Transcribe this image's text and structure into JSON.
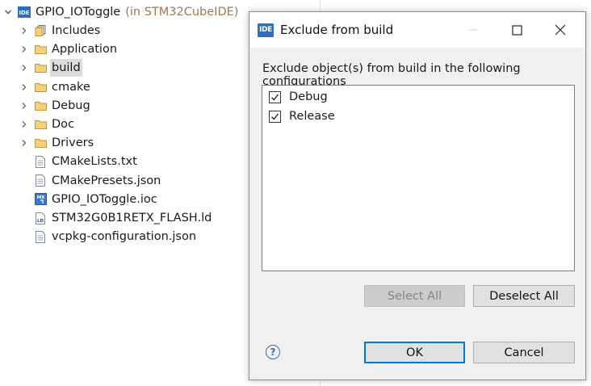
{
  "project": {
    "name": "GPIO_IOToggle",
    "suffix": "(in STM32CubeIDE)",
    "icon": "ide-project-icon"
  },
  "tree": {
    "items": [
      {
        "label": "Includes",
        "icon": "includes-icon",
        "expandable": true
      },
      {
        "label": "Application",
        "icon": "folder-icon",
        "expandable": true
      },
      {
        "label": "build",
        "icon": "folder-icon",
        "expandable": true,
        "selected": true
      },
      {
        "label": "cmake",
        "icon": "folder-icon",
        "expandable": true
      },
      {
        "label": "Debug",
        "icon": "folder-icon",
        "expandable": true
      },
      {
        "label": "Doc",
        "icon": "folder-icon",
        "expandable": true
      },
      {
        "label": "Drivers",
        "icon": "folder-icon",
        "expandable": true
      },
      {
        "label": "CMakeLists.txt",
        "icon": "file-icon",
        "expandable": false
      },
      {
        "label": "CMakePresets.json",
        "icon": "file-icon",
        "expandable": false
      },
      {
        "label": "GPIO_IOToggle.ioc",
        "icon": "ioc-file-icon",
        "expandable": false
      },
      {
        "label": "STM32G0B1RETX_FLASH.ld",
        "icon": "linker-file-icon",
        "expandable": false
      },
      {
        "label": "vcpkg-configuration.json",
        "icon": "file-icon",
        "expandable": false
      }
    ]
  },
  "dialog": {
    "title": "Exclude from build",
    "app_icon_text": "IDE",
    "instruction": "Exclude object(s) from build in the following configurations",
    "configurations": [
      {
        "label": "Debug",
        "checked": true
      },
      {
        "label": "Release",
        "checked": true
      }
    ],
    "select_all_label": "Select All",
    "deselect_all_label": "Deselect All",
    "ok_label": "OK",
    "cancel_label": "Cancel",
    "help_glyph": "?"
  },
  "colors": {
    "accent": "#0078d7",
    "project_suffix": "#9a7b4f",
    "folder": "#e8b84a",
    "ide_blue": "#2f6fbf"
  }
}
